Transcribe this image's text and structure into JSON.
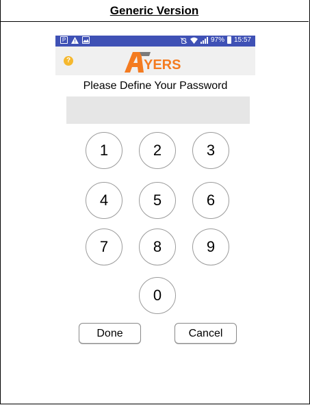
{
  "document": {
    "title": "Generic Version"
  },
  "statusbar": {
    "battery": "97%",
    "time": "15:57",
    "left_icons": [
      "p-icon",
      "warning-icon",
      "image-icon"
    ]
  },
  "app": {
    "logo_accent": "A",
    "logo_text": "YERS",
    "logo_color": "#F47B20"
  },
  "screen": {
    "prompt": "Please Define Your Password",
    "password_value": ""
  },
  "keypad": {
    "keys": [
      "1",
      "2",
      "3",
      "4",
      "5",
      "6",
      "7",
      "8",
      "9",
      "0"
    ]
  },
  "buttons": {
    "done": "Done",
    "cancel": "Cancel"
  }
}
